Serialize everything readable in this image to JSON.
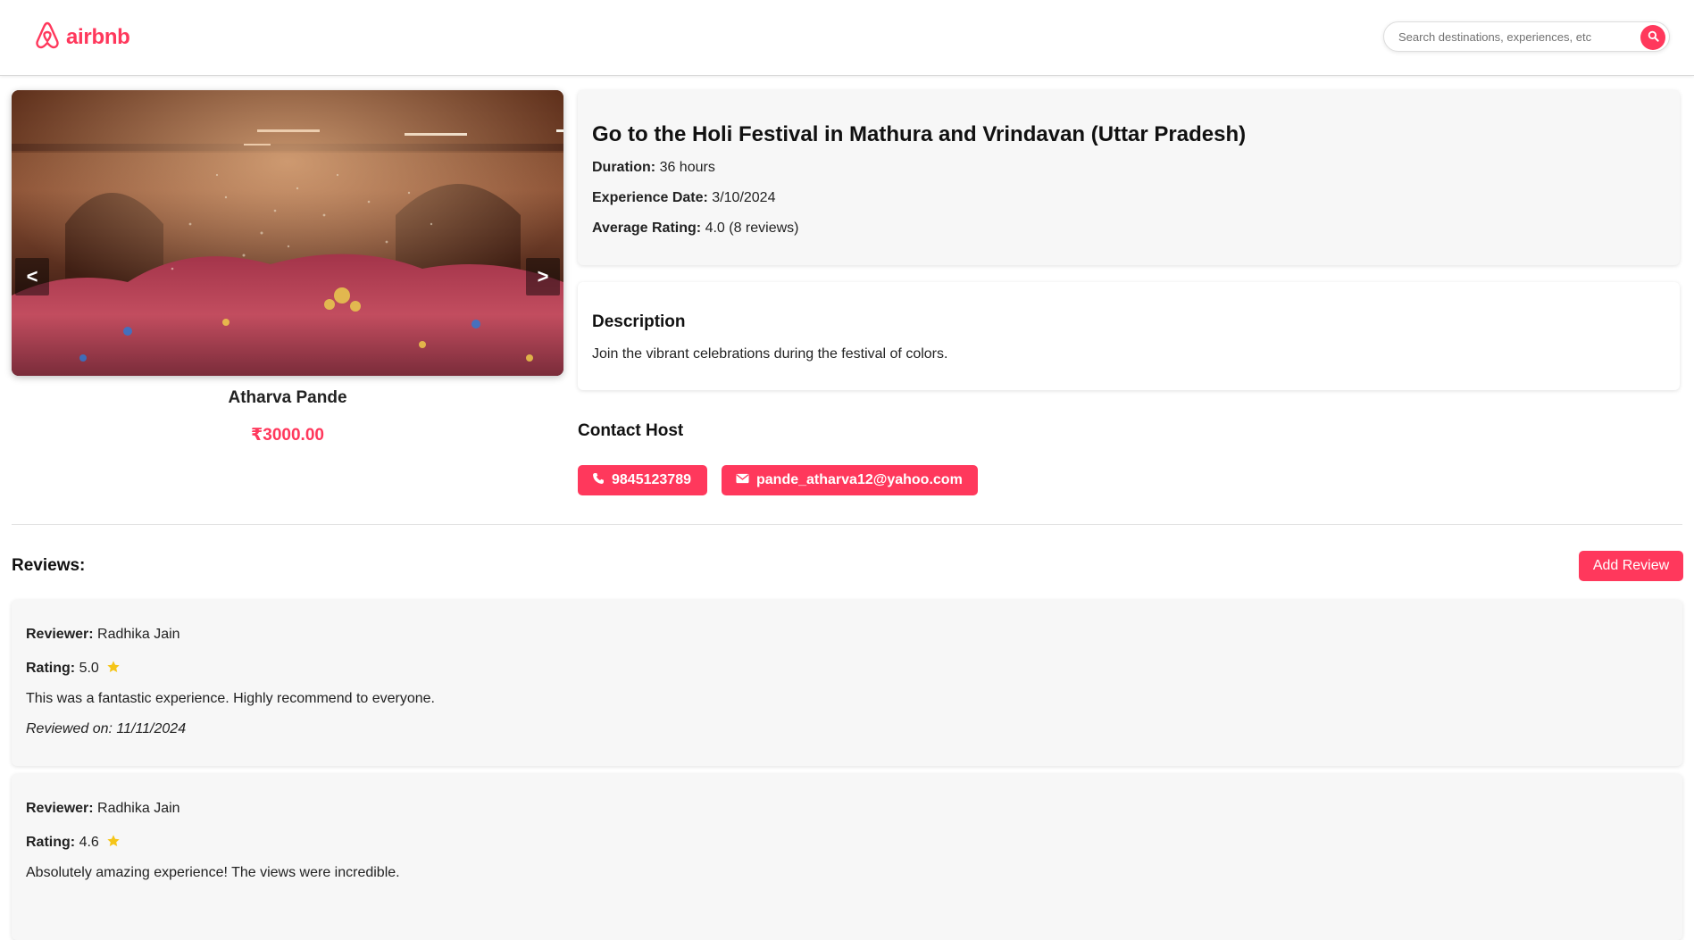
{
  "header": {
    "logo_text": "airbnb",
    "search_placeholder": "Search destinations, experiences, etc",
    "brand_color": "#ff385c"
  },
  "gallery": {
    "prev_label": "<",
    "next_label": ">"
  },
  "host": {
    "name": "Atharva Pande",
    "price": "₹3000.00"
  },
  "experience": {
    "title": "Go to the Holi Festival in Mathura and Vrindavan (Uttar Pradesh)",
    "duration_label": "Duration:",
    "duration_value": "36 hours",
    "date_label": "Experience Date:",
    "date_value": "3/10/2024",
    "rating_label": "Average Rating:",
    "rating_value": "4.0 (8 reviews)"
  },
  "description": {
    "heading": "Description",
    "text": "Join the vibrant celebrations during the festival of colors."
  },
  "contact": {
    "heading": "Contact Host",
    "phone": "9845123789",
    "email": "pande_atharva12@yahoo.com"
  },
  "reviews": {
    "heading": "Reviews:",
    "add_label": "Add Review",
    "reviewer_label": "Reviewer:",
    "rating_label": "Rating:",
    "items": [
      {
        "reviewer": "Radhika Jain",
        "rating": "5.0",
        "comment": "This was a fantastic experience. Highly recommend to everyone.",
        "date": "Reviewed on: 11/11/2024"
      },
      {
        "reviewer": "Radhika Jain",
        "rating": "4.6",
        "comment": "Absolutely amazing experience! The views were incredible."
      }
    ]
  }
}
